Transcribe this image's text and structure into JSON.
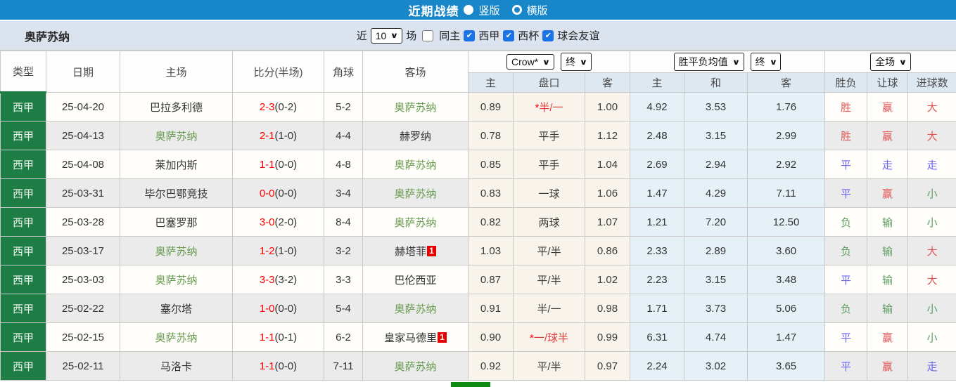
{
  "topbar": {
    "title": "近期战绩",
    "radio_vertical_label": "竖版",
    "radio_horizontal_label": "横版",
    "selected_layout": "竖版"
  },
  "filterbar": {
    "team": "奥萨苏纳",
    "recent_label": "近",
    "match_count": "10",
    "games_label": "场",
    "same_home_label": "同主",
    "leagues": [
      "西甲",
      "西杯",
      "球会友谊"
    ],
    "leagues_checked": [
      true,
      true,
      true
    ],
    "same_home_checked": false
  },
  "controls": {
    "bookmaker": "Crow*",
    "bookmaker_state": "终",
    "avg_label": "胜平负均值",
    "avg_state": "终",
    "scope": "全场"
  },
  "table": {
    "headers": {
      "type": "类型",
      "date": "日期",
      "home": "主场",
      "score": "比分(半场)",
      "corner": "角球",
      "away": "客场",
      "odds_home": "主",
      "handicap": "盘口",
      "odds_away": "客",
      "avg_home": "主",
      "avg_draw": "和",
      "avg_away": "客",
      "wdl": "胜负",
      "handicap_result": "让球",
      "goals_result": "进球数"
    },
    "rows": [
      {
        "type": "西甲",
        "date": "25-04-20",
        "home": "巴拉多利德",
        "home_focus": false,
        "home_card": "",
        "score_ft": "2-3",
        "score_ht": "(0-2)",
        "corner": "5-2",
        "away": "奥萨苏纳",
        "away_focus": true,
        "away_card": "",
        "odds_home": "0.89",
        "handicap_star": "*",
        "handicap": "半/一",
        "odds_away": "1.00",
        "avg_home": "4.92",
        "avg_draw": "3.53",
        "avg_away": "1.76",
        "wdl": "胜",
        "hr": "赢",
        "gr": "大"
      },
      {
        "type": "西甲",
        "date": "25-04-13",
        "home": "奥萨苏纳",
        "home_focus": true,
        "home_card": "",
        "score_ft": "2-1",
        "score_ht": "(1-0)",
        "corner": "4-4",
        "away": "赫罗纳",
        "away_focus": false,
        "away_card": "",
        "odds_home": "0.78",
        "handicap_star": "",
        "handicap": "平手",
        "odds_away": "1.12",
        "avg_home": "2.48",
        "avg_draw": "3.15",
        "avg_away": "2.99",
        "wdl": "胜",
        "hr": "赢",
        "gr": "大"
      },
      {
        "type": "西甲",
        "date": "25-04-08",
        "home": "莱加内斯",
        "home_focus": false,
        "home_card": "",
        "score_ft": "1-1",
        "score_ht": "(0-0)",
        "corner": "4-8",
        "away": "奥萨苏纳",
        "away_focus": true,
        "away_card": "",
        "odds_home": "0.85",
        "handicap_star": "",
        "handicap": "平手",
        "odds_away": "1.04",
        "avg_home": "2.69",
        "avg_draw": "2.94",
        "avg_away": "2.92",
        "wdl": "平",
        "hr": "走",
        "gr": "走"
      },
      {
        "type": "西甲",
        "date": "25-03-31",
        "home": "毕尔巴鄂竞技",
        "home_focus": false,
        "home_card": "",
        "score_ft": "0-0",
        "score_ht": "(0-0)",
        "corner": "3-4",
        "away": "奥萨苏纳",
        "away_focus": true,
        "away_card": "",
        "odds_home": "0.83",
        "handicap_star": "",
        "handicap": "一球",
        "odds_away": "1.06",
        "avg_home": "1.47",
        "avg_draw": "4.29",
        "avg_away": "7.11",
        "wdl": "平",
        "hr": "赢",
        "gr": "小"
      },
      {
        "type": "西甲",
        "date": "25-03-28",
        "home": "巴塞罗那",
        "home_focus": false,
        "home_card": "",
        "score_ft": "3-0",
        "score_ht": "(2-0)",
        "corner": "8-4",
        "away": "奥萨苏纳",
        "away_focus": true,
        "away_card": "",
        "odds_home": "0.82",
        "handicap_star": "",
        "handicap": "两球",
        "odds_away": "1.07",
        "avg_home": "1.21",
        "avg_draw": "7.20",
        "avg_away": "12.50",
        "wdl": "负",
        "hr": "输",
        "gr": "小"
      },
      {
        "type": "西甲",
        "date": "25-03-17",
        "home": "奥萨苏纳",
        "home_focus": true,
        "home_card": "",
        "score_ft": "1-2",
        "score_ht": "(1-0)",
        "corner": "3-2",
        "away": "赫塔菲",
        "away_focus": false,
        "away_card": "1",
        "odds_home": "1.03",
        "handicap_star": "",
        "handicap": "平/半",
        "odds_away": "0.86",
        "avg_home": "2.33",
        "avg_draw": "2.89",
        "avg_away": "3.60",
        "wdl": "负",
        "hr": "输",
        "gr": "大"
      },
      {
        "type": "西甲",
        "date": "25-03-03",
        "home": "奥萨苏纳",
        "home_focus": true,
        "home_card": "",
        "score_ft": "3-3",
        "score_ht": "(3-2)",
        "corner": "3-3",
        "away": "巴伦西亚",
        "away_focus": false,
        "away_card": "",
        "odds_home": "0.87",
        "handicap_star": "",
        "handicap": "平/半",
        "odds_away": "1.02",
        "avg_home": "2.23",
        "avg_draw": "3.15",
        "avg_away": "3.48",
        "wdl": "平",
        "hr": "输",
        "gr": "大"
      },
      {
        "type": "西甲",
        "date": "25-02-22",
        "home": "塞尔塔",
        "home_focus": false,
        "home_card": "",
        "score_ft": "1-0",
        "score_ht": "(0-0)",
        "corner": "5-4",
        "away": "奥萨苏纳",
        "away_focus": true,
        "away_card": "",
        "odds_home": "0.91",
        "handicap_star": "",
        "handicap": "半/一",
        "odds_away": "0.98",
        "avg_home": "1.71",
        "avg_draw": "3.73",
        "avg_away": "5.06",
        "wdl": "负",
        "hr": "输",
        "gr": "小"
      },
      {
        "type": "西甲",
        "date": "25-02-15",
        "home": "奥萨苏纳",
        "home_focus": true,
        "home_card": "",
        "score_ft": "1-1",
        "score_ht": "(0-1)",
        "corner": "6-2",
        "away": "皇家马德里",
        "away_focus": false,
        "away_card": "1",
        "odds_home": "0.90",
        "handicap_star": "*",
        "handicap": "一/球半",
        "odds_away": "0.99",
        "avg_home": "6.31",
        "avg_draw": "4.74",
        "avg_away": "1.47",
        "wdl": "平",
        "hr": "赢",
        "gr": "小"
      },
      {
        "type": "西甲",
        "date": "25-02-11",
        "home": "马洛卡",
        "home_focus": false,
        "home_card": "",
        "score_ft": "1-1",
        "score_ht": "(0-0)",
        "corner": "7-11",
        "away": "奥萨苏纳",
        "away_focus": true,
        "away_card": "",
        "odds_home": "0.92",
        "handicap_star": "",
        "handicap": "平/半",
        "odds_away": "0.97",
        "avg_home": "2.24",
        "avg_draw": "3.02",
        "avg_away": "3.65",
        "wdl": "平",
        "hr": "赢",
        "gr": "走"
      }
    ]
  },
  "colors": {
    "topbar_blue": "#1887c9",
    "filter_bg": "#dbe3ee",
    "header_bg": "#dee8f1",
    "league_green": "#1e7c45",
    "row_alt_gray": "#ebebeb",
    "odds_cream": "#f8f4eb",
    "avg_blue": "#e5f0f7",
    "score_red": "#ff0000",
    "focus_team_green": "#679a4e",
    "result_red": "#e25555",
    "result_blue": "#6b66ee",
    "result_green": "#5f9e63",
    "red_card": "#e60000",
    "checkbox_blue": "#1a74e8",
    "bottom_bar_green": "#0f8a10"
  }
}
